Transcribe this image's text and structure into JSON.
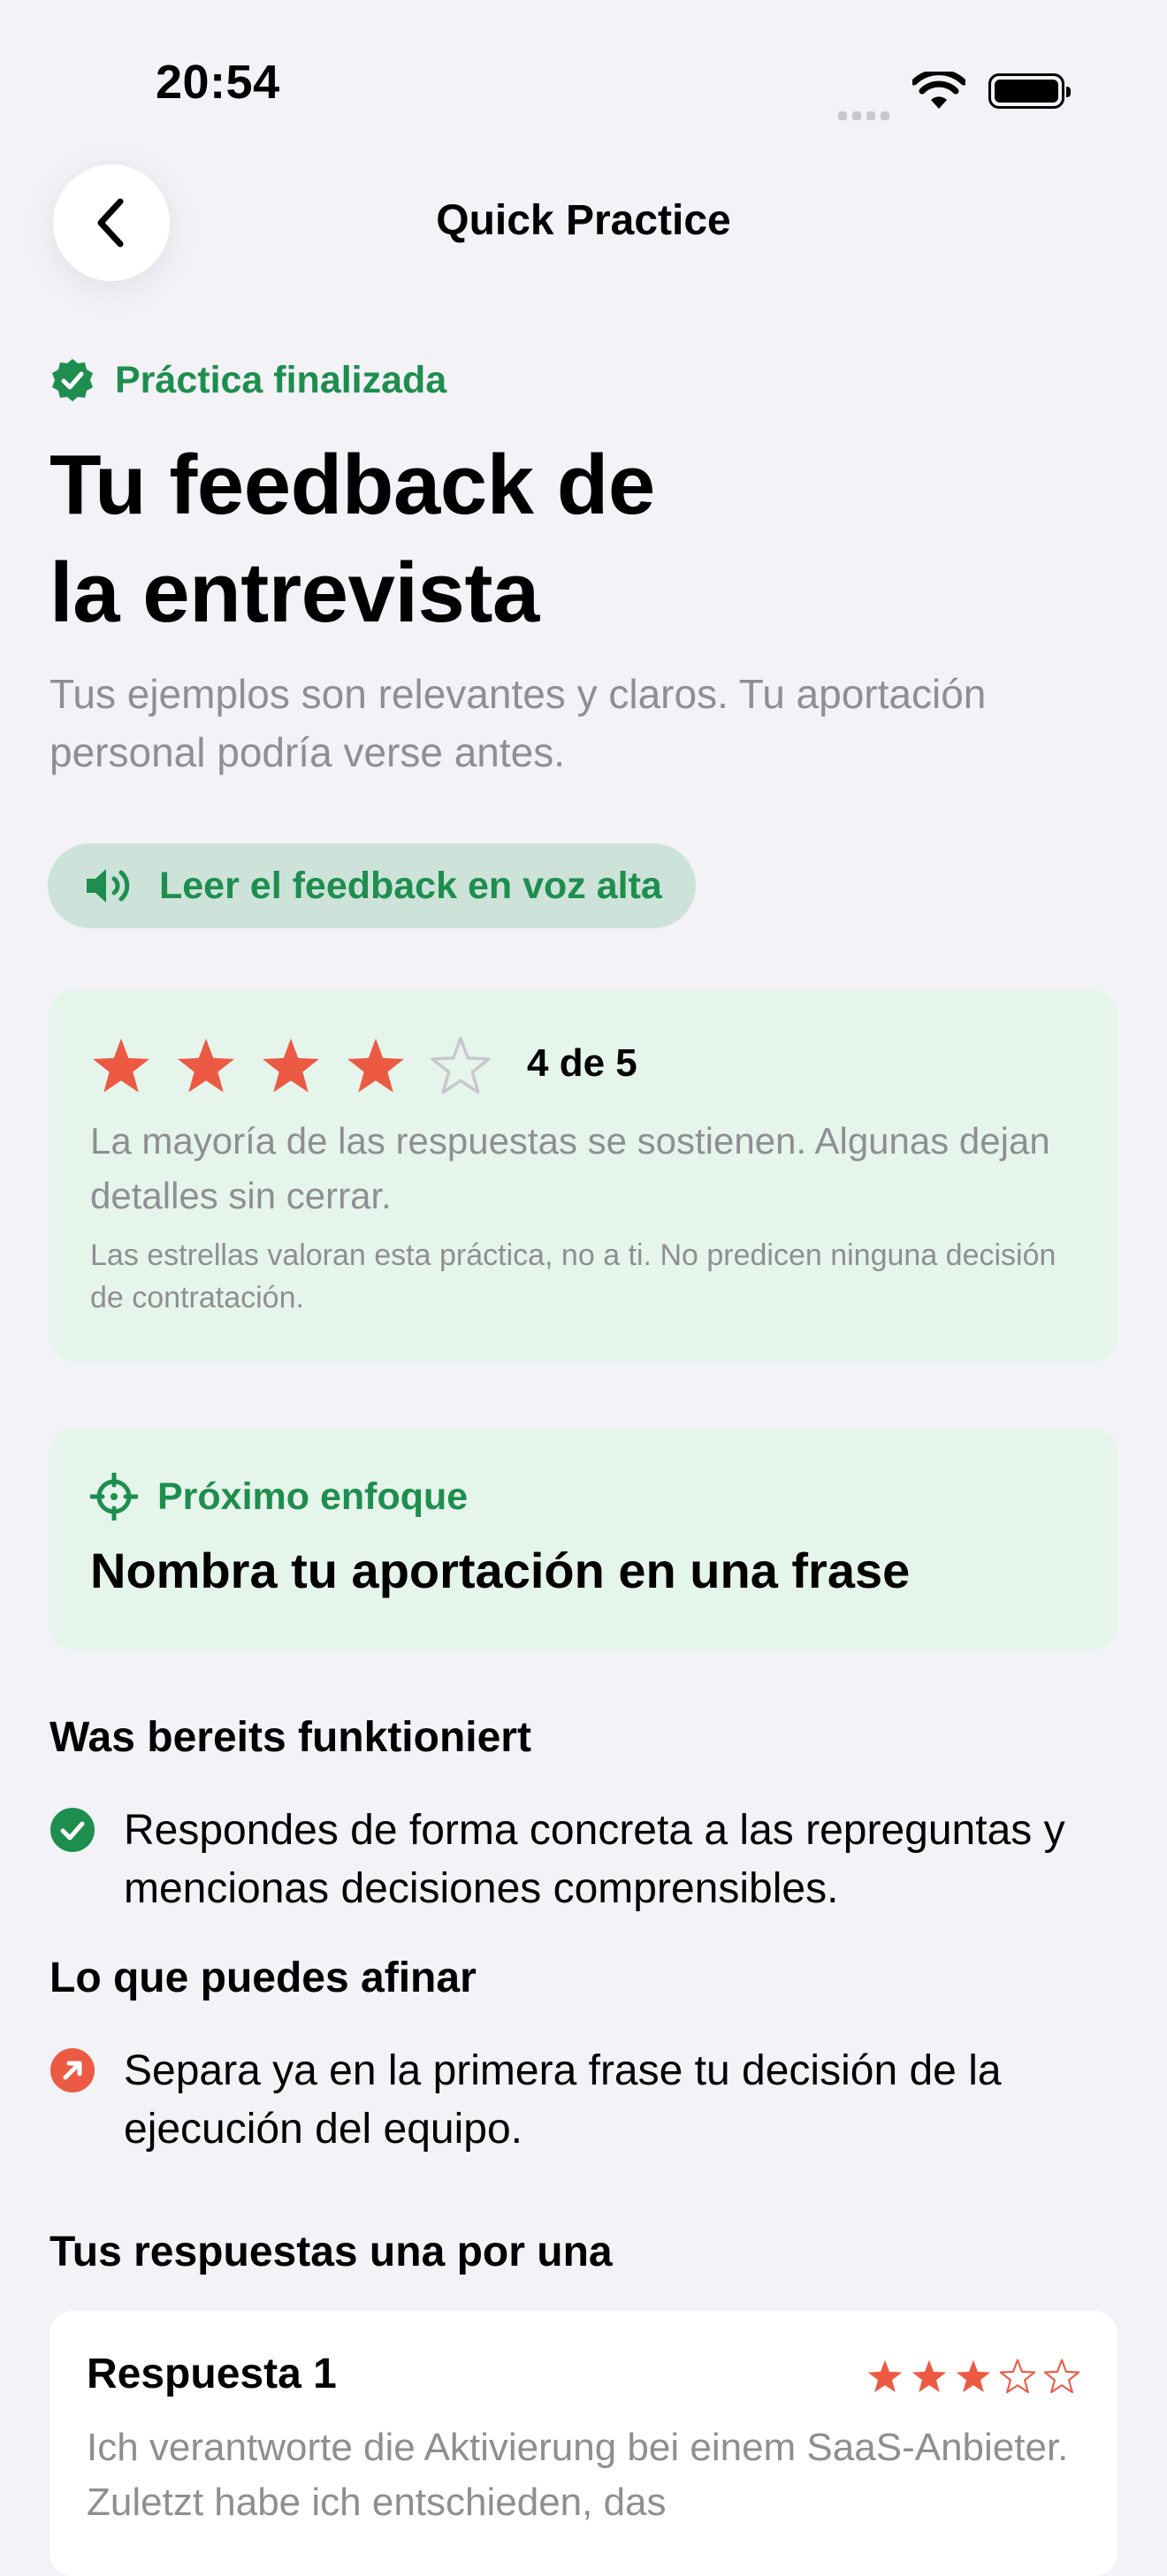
{
  "status_bar": {
    "time": "20:54"
  },
  "nav": {
    "title": "Quick Practice"
  },
  "header": {
    "badge": "Práctica finalizada",
    "title_line1": "Tu feedback de",
    "title_line2": "la entrevista",
    "subtitle": "Tus ejemplos son relevantes y claros. Tu aportación personal podría verse antes.",
    "read_aloud_label": "Leer el feedback en voz alta"
  },
  "rating": {
    "value": 4,
    "max": 5,
    "label": "4 de 5",
    "description": "La mayoría de las respuestas se sostienen. Algunas dejan detalles sin cerrar.",
    "note": "Las estrellas valoran esta práctica, no a ti. No predicen ninguna decisión de contratación."
  },
  "focus": {
    "label": "Próximo enfoque",
    "text": "Nombra tu aportación en una frase"
  },
  "strengths": {
    "heading": "Was bereits funktioniert",
    "items": [
      "Respondes de forma concreta a las repreguntas y mencionas decisiones comprensibles."
    ]
  },
  "improvements": {
    "heading": "Lo que puedes afinar",
    "items": [
      "Separa ya en la primera frase tu decisión de la ejecución del equipo."
    ]
  },
  "answers": {
    "heading": "Tus respuestas una por una",
    "items": [
      {
        "title": "Respuesta 1",
        "rating": 3,
        "max": 5,
        "text": "Ich verantworte die Aktivierung bei einem SaaS-Anbieter. Zuletzt habe ich entschieden, das"
      }
    ]
  },
  "colors": {
    "accent_green": "#1e8e4e",
    "star_red": "#ec5a44",
    "card_green": "#e6f5ec"
  }
}
